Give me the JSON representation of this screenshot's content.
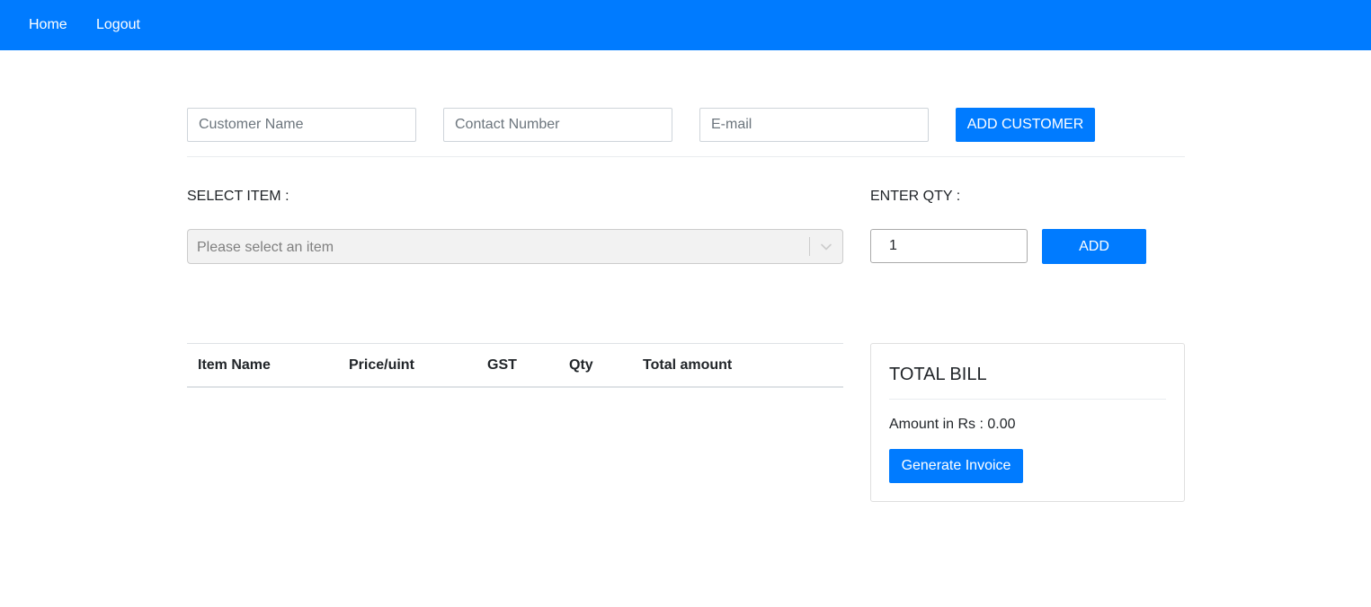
{
  "nav": {
    "home_label": "Home",
    "logout_label": "Logout"
  },
  "customer_form": {
    "name_placeholder": "Customer Name",
    "contact_placeholder": "Contact Number",
    "email_placeholder": "E-mail",
    "add_button_label": "ADD CUSTOMER"
  },
  "item_form": {
    "select_label": "SELECT ITEM :",
    "select_placeholder": "Please select an item",
    "qty_label": "ENTER QTY :",
    "qty_value": "1",
    "add_button_label": "ADD"
  },
  "table": {
    "columns": [
      "Item Name",
      "Price/uint",
      "GST",
      "Qty",
      "Total amount"
    ],
    "rows": []
  },
  "bill": {
    "title": "TOTAL BILL",
    "amount_text": "Amount in Rs : 0.00",
    "generate_button_label": "Generate Invoice"
  },
  "icons": {
    "select_indicator": "chevron-down-icon"
  },
  "colors": {
    "primary": "#007bff",
    "navbar": "#007bff"
  }
}
